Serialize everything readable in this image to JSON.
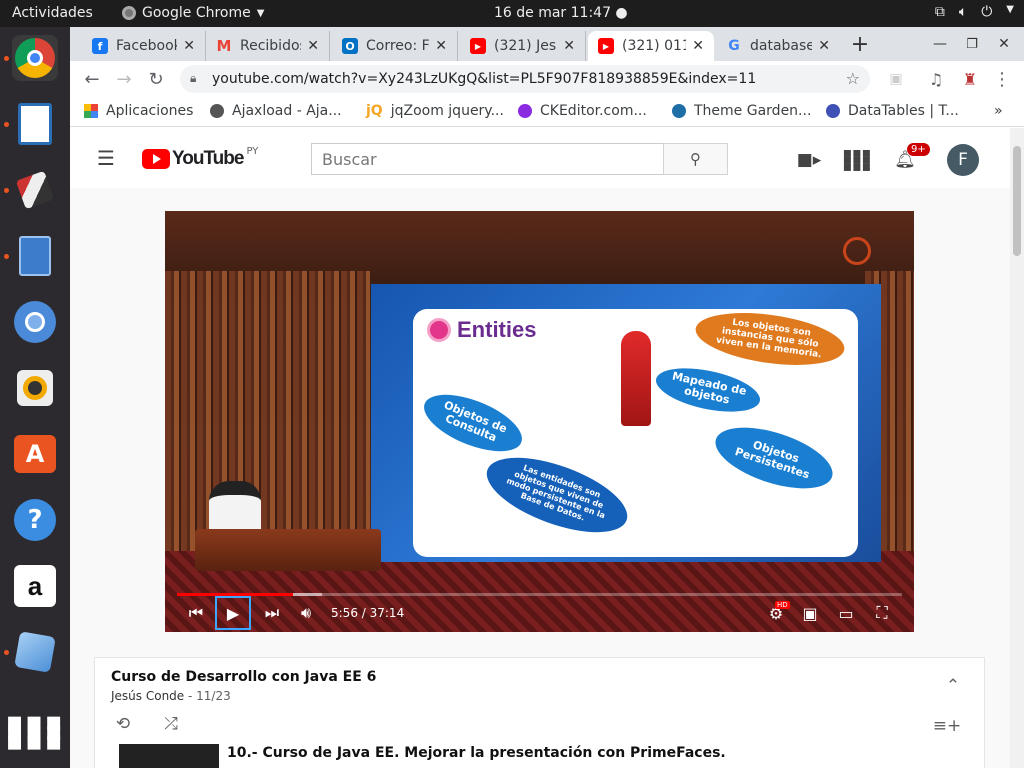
{
  "system": {
    "activities": "Actividades",
    "app_name": "Google Chrome",
    "clock": "16 de mar  11:47 ●"
  },
  "dock": {
    "items": [
      "chrome-icon",
      "document-viewer-icon",
      "drawing-icon",
      "file-cabinet-icon",
      "chromium-icon",
      "music-player-icon",
      "software-center-icon",
      "help-icon",
      "amazon-icon",
      "virtualbox-icon",
      "app-grid-icon"
    ]
  },
  "tabs": [
    {
      "title": "Facebook",
      "favicon": "f",
      "color": "#1877f2"
    },
    {
      "title": "Recibidos",
      "favicon": "M",
      "color": "#ea4335"
    },
    {
      "title": "Correo: F",
      "favicon": "O",
      "color": "#0072c6"
    },
    {
      "title": "(321) Jes",
      "favicon": "▶",
      "color": "#ff0000"
    },
    {
      "title": "(321) 011",
      "favicon": "▶",
      "color": "#ff0000"
    },
    {
      "title": "database",
      "favicon": "G",
      "color": "#4285f4"
    }
  ],
  "url": "youtube.com/watch?v=Xy243LzUKgQ&list=PL5F907F818938859E&index=11",
  "bookmarks": [
    {
      "label": "Aplicaciones",
      "color": "#4285f4"
    },
    {
      "label": "Ajaxload - Aja...",
      "color": "#555"
    },
    {
      "label": "jqZoom jquery...",
      "color": "#f5a623"
    },
    {
      "label": "CKEditor.com...",
      "color": "#8a2be2"
    },
    {
      "label": "Theme Garden...",
      "color": "#1e6fa8"
    },
    {
      "label": "DataTables | T...",
      "color": "#3f51b5"
    }
  ],
  "youtube": {
    "logo_text": "YouTube",
    "country": "PY",
    "search_placeholder": "Buscar",
    "notifications": "9+",
    "avatar_letter": "F"
  },
  "video": {
    "slide_title": "Entities",
    "bubbles": [
      "Los objetos son instancias que sólo viven en la memoria.",
      "Mapeado de objetos",
      "Objetos de Consulta",
      "Objetos Persistentes",
      "Las entidades son objetos que viven de modo persistente en la Base de Datos."
    ],
    "time": "5:56 / 37:14",
    "progress": 0.16,
    "buffered": 0.2,
    "hd_badge": "HD"
  },
  "playlist": {
    "title": "Curso de Desarrollo con Java EE 6",
    "author": "Jesús Conde",
    "position": " - 11/23",
    "next_item": "10.- Curso de Java EE. Mejorar la presentación con PrimeFaces."
  }
}
